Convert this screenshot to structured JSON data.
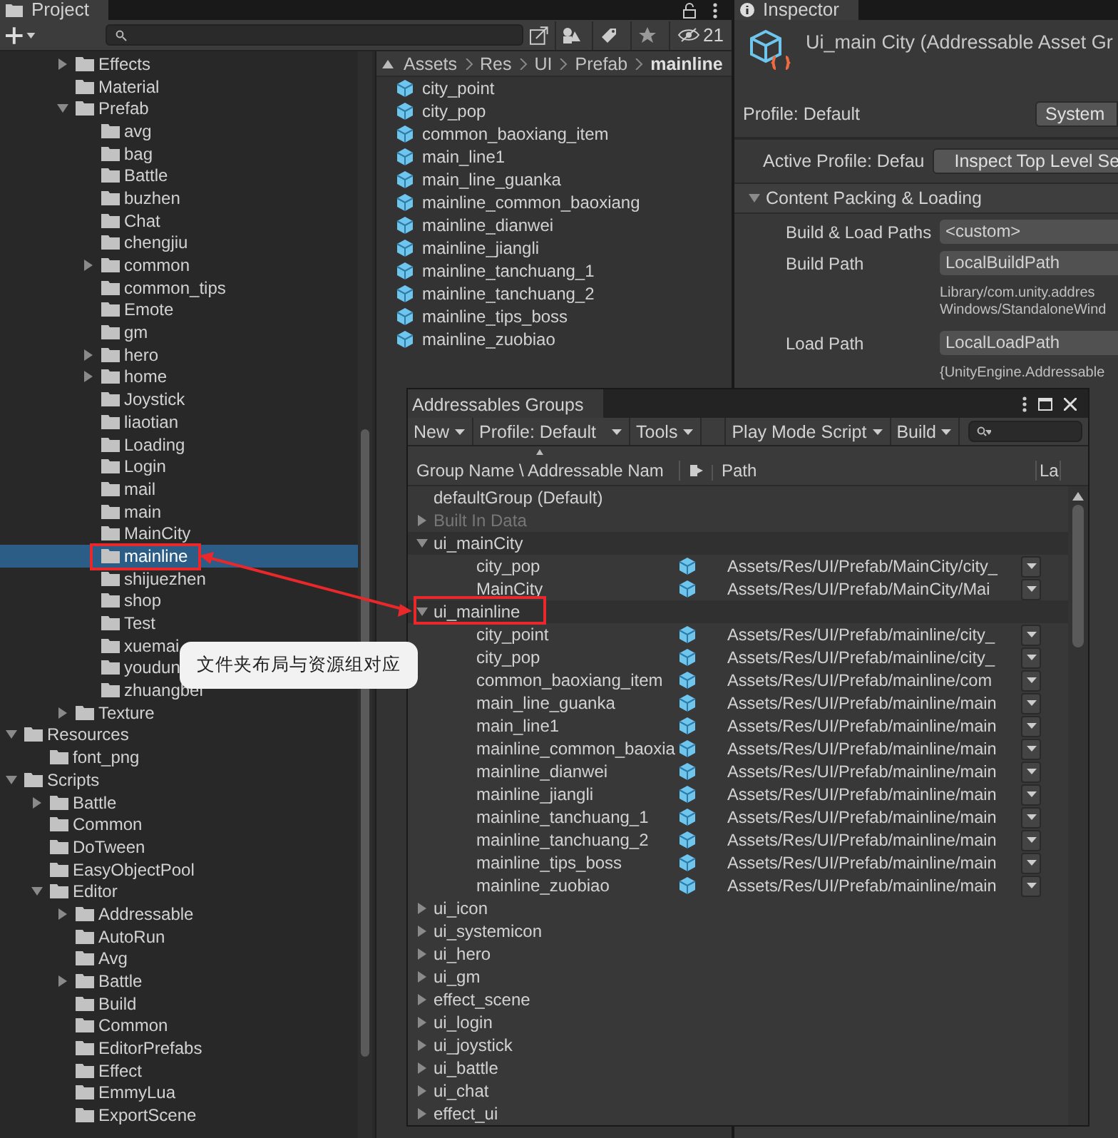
{
  "project_panel": {
    "tab": "Project",
    "hidden_count": "21",
    "tree": [
      {
        "children": [
          {
            "children": [
              {
                "label": "Effects",
                "expanded": false,
                "selected": false
              },
              {
                "label": "Material",
                "selected": false
              },
              {
                "label": "Prefab",
                "expanded": true,
                "selected": false,
                "children": [
                  {
                    "label": "avg",
                    "selected": false
                  },
                  {
                    "label": "bag",
                    "selected": false
                  },
                  {
                    "label": "Battle",
                    "selected": false
                  },
                  {
                    "label": "buzhen",
                    "selected": false
                  },
                  {
                    "label": "Chat",
                    "selected": false
                  },
                  {
                    "label": "chengjiu",
                    "selected": false
                  },
                  {
                    "label": "common",
                    "expanded": false,
                    "selected": false
                  },
                  {
                    "label": "common_tips",
                    "selected": false
                  },
                  {
                    "label": "Emote",
                    "selected": false
                  },
                  {
                    "label": "gm",
                    "selected": false
                  },
                  {
                    "label": "hero",
                    "expanded": false,
                    "selected": false
                  },
                  {
                    "label": "home",
                    "expanded": false,
                    "selected": false
                  },
                  {
                    "label": "Joystick",
                    "selected": false
                  },
                  {
                    "label": "liaotian",
                    "selected": false
                  },
                  {
                    "label": "Loading",
                    "selected": false
                  },
                  {
                    "label": "Login",
                    "selected": false
                  },
                  {
                    "label": "mail",
                    "selected": false
                  },
                  {
                    "label": "main",
                    "selected": false
                  },
                  {
                    "label": "MainCity",
                    "selected": false
                  },
                  {
                    "label": "mainline",
                    "selected": true
                  },
                  {
                    "label": "shijuezhen",
                    "selected": false
                  },
                  {
                    "label": "shop",
                    "selected": false
                  },
                  {
                    "label": "Test",
                    "selected": false
                  },
                  {
                    "label": "xuemai",
                    "selected": false
                  },
                  {
                    "label": "youdun",
                    "selected": false
                  },
                  {
                    "label": "zhuangbei",
                    "selected": false
                  }
                ]
              },
              {
                "label": "Texture",
                "expanded": false,
                "selected": false
              }
            ]
          }
        ]
      },
      {
        "label": "Resources",
        "expanded": true,
        "selected": false,
        "children": [
          {
            "label": "font_png",
            "selected": false
          }
        ]
      },
      {
        "label": "Scripts",
        "expanded": true,
        "selected": false,
        "children": [
          {
            "label": "Battle",
            "expanded": false,
            "selected": false
          },
          {
            "label": "Common",
            "selected": false
          },
          {
            "label": "DoTween",
            "selected": false
          },
          {
            "label": "EasyObjectPool",
            "selected": false
          },
          {
            "label": "Editor",
            "expanded": true,
            "selected": false,
            "children": [
              {
                "label": "Addressable",
                "expanded": false,
                "selected": false
              },
              {
                "label": "AutoRun",
                "selected": false
              },
              {
                "label": "Avg",
                "selected": false
              },
              {
                "label": "Battle",
                "expanded": false,
                "selected": false
              },
              {
                "label": "Build",
                "selected": false
              },
              {
                "label": "Common",
                "selected": false
              },
              {
                "label": "EditorPrefabs",
                "selected": false
              },
              {
                "label": "Effect",
                "selected": false
              },
              {
                "label": "EmmyLua",
                "selected": false
              },
              {
                "label": "ExportScene",
                "selected": false
              }
            ]
          }
        ]
      }
    ],
    "breadcrumb": [
      "Assets",
      "Res",
      "UI",
      "Prefab",
      "mainline"
    ],
    "files": [
      "city_point",
      "city_pop",
      "common_baoxiang_item",
      "main_line1",
      "main_line_guanka",
      "mainline_common_baoxiang",
      "mainline_dianwei",
      "mainline_jiangli",
      "mainline_tanchuang_1",
      "mainline_tanchuang_2",
      "mainline_tips_boss",
      "mainline_zuobiao"
    ]
  },
  "inspector": {
    "tab": "Inspector",
    "title": "Ui_main City (Addressable Asset Gr",
    "profile_label": "Profile: Default",
    "profile_button": "System",
    "active_profile_label": "Active Profile: Defau",
    "inspect_button": "Inspect Top Level Se",
    "section": {
      "title": "Content Packing & Loading",
      "expanded": true
    },
    "fields": [
      {
        "label": "Build & Load Paths",
        "value": "<custom>"
      },
      {
        "label": "Build Path",
        "value": "LocalBuildPath",
        "note": [
          "Library/com.unity.addres",
          "Windows/StandaloneWind"
        ]
      },
      {
        "label": "Load Path",
        "value": "LocalLoadPath",
        "note": [
          "{UnityEngine.Addressable"
        ]
      }
    ]
  },
  "groups_window": {
    "title": "Addressables Groups",
    "toolbar": [
      {
        "label": "New"
      },
      {
        "label": "Profile: Default"
      },
      {
        "label": "Tools"
      },
      {
        "label": "Play Mode Script"
      },
      {
        "label": "Build"
      }
    ],
    "columns": [
      "Group Name \\ Addressable Nam",
      "Path",
      "La"
    ],
    "groups": [
      {
        "name": "defaultGroup (Default)",
        "disabled": false
      },
      {
        "name": "Built In Data",
        "expanded": false,
        "disabled": true
      },
      {
        "name": "ui_mainCity",
        "expanded": true,
        "disabled": false,
        "entries": [
          {
            "name": "city_pop",
            "path": "Assets/Res/UI/Prefab/MainCity/city_"
          },
          {
            "name": "MainCity",
            "path": "Assets/Res/UI/Prefab/MainCity/Mai"
          }
        ]
      },
      {
        "name": "ui_mainline",
        "expanded": true,
        "disabled": false,
        "entries": [
          {
            "name": "city_point",
            "path": "Assets/Res/UI/Prefab/mainline/city_"
          },
          {
            "name": "city_pop",
            "path": "Assets/Res/UI/Prefab/mainline/city_"
          },
          {
            "name": "common_baoxiang_item",
            "path": "Assets/Res/UI/Prefab/mainline/com"
          },
          {
            "name": "main_line_guanka",
            "path": "Assets/Res/UI/Prefab/mainline/main"
          },
          {
            "name": "main_line1",
            "path": "Assets/Res/UI/Prefab/mainline/main"
          },
          {
            "name": "mainline_common_baoxia",
            "path": "Assets/Res/UI/Prefab/mainline/main"
          },
          {
            "name": "mainline_dianwei",
            "path": "Assets/Res/UI/Prefab/mainline/main"
          },
          {
            "name": "mainline_jiangli",
            "path": "Assets/Res/UI/Prefab/mainline/main"
          },
          {
            "name": "mainline_tanchuang_1",
            "path": "Assets/Res/UI/Prefab/mainline/main"
          },
          {
            "name": "mainline_tanchuang_2",
            "path": "Assets/Res/UI/Prefab/mainline/main"
          },
          {
            "name": "mainline_tips_boss",
            "path": "Assets/Res/UI/Prefab/mainline/main"
          },
          {
            "name": "mainline_zuobiao",
            "path": "Assets/Res/UI/Prefab/mainline/main"
          }
        ]
      },
      {
        "name": "ui_icon",
        "expanded": false,
        "disabled": false
      },
      {
        "name": "ui_systemicon",
        "expanded": false,
        "disabled": false
      },
      {
        "name": "ui_hero",
        "expanded": false,
        "disabled": false
      },
      {
        "name": "ui_gm",
        "expanded": false,
        "disabled": false
      },
      {
        "name": "effect_scene",
        "expanded": false,
        "disabled": false
      },
      {
        "name": "ui_login",
        "expanded": false,
        "disabled": false
      },
      {
        "name": "ui_joystick",
        "expanded": false,
        "disabled": false
      },
      {
        "name": "ui_battle",
        "expanded": false,
        "disabled": false
      },
      {
        "name": "ui_chat",
        "expanded": false,
        "disabled": false
      },
      {
        "name": "effect_ui",
        "expanded": false,
        "disabled": false
      }
    ]
  },
  "callout": {
    "text": "文件夹布局与资源组对应"
  }
}
